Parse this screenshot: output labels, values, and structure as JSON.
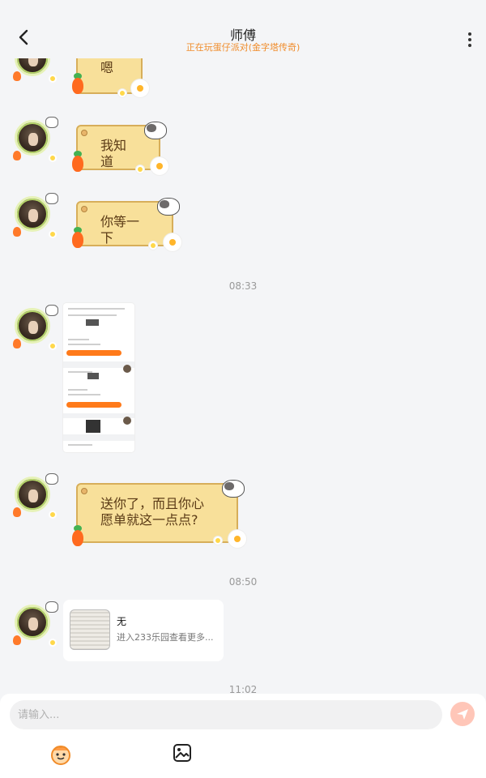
{
  "header": {
    "title": "师傅",
    "subtitle": "正在玩蛋仔派对(金字塔传奇)"
  },
  "messages": {
    "m1_text": "嗯",
    "m2_text": "我知道",
    "m3_text": "你等一下",
    "time_1": "08:33",
    "m5_text": "送你了，而且你心愿单就这一点点?",
    "time_2": "08:50",
    "card_title": "无",
    "card_desc": "进入233乐园查看更多...",
    "time_3": "11:02"
  },
  "input": {
    "placeholder": "请输入..."
  },
  "colors": {
    "accent": "#f08c2a",
    "bubble_bg": "#f8e09a",
    "bubble_border": "#d7ae5a"
  },
  "icons": [
    "back-arrow-icon",
    "more-icon",
    "send-icon",
    "emoji-icon",
    "gallery-icon"
  ]
}
